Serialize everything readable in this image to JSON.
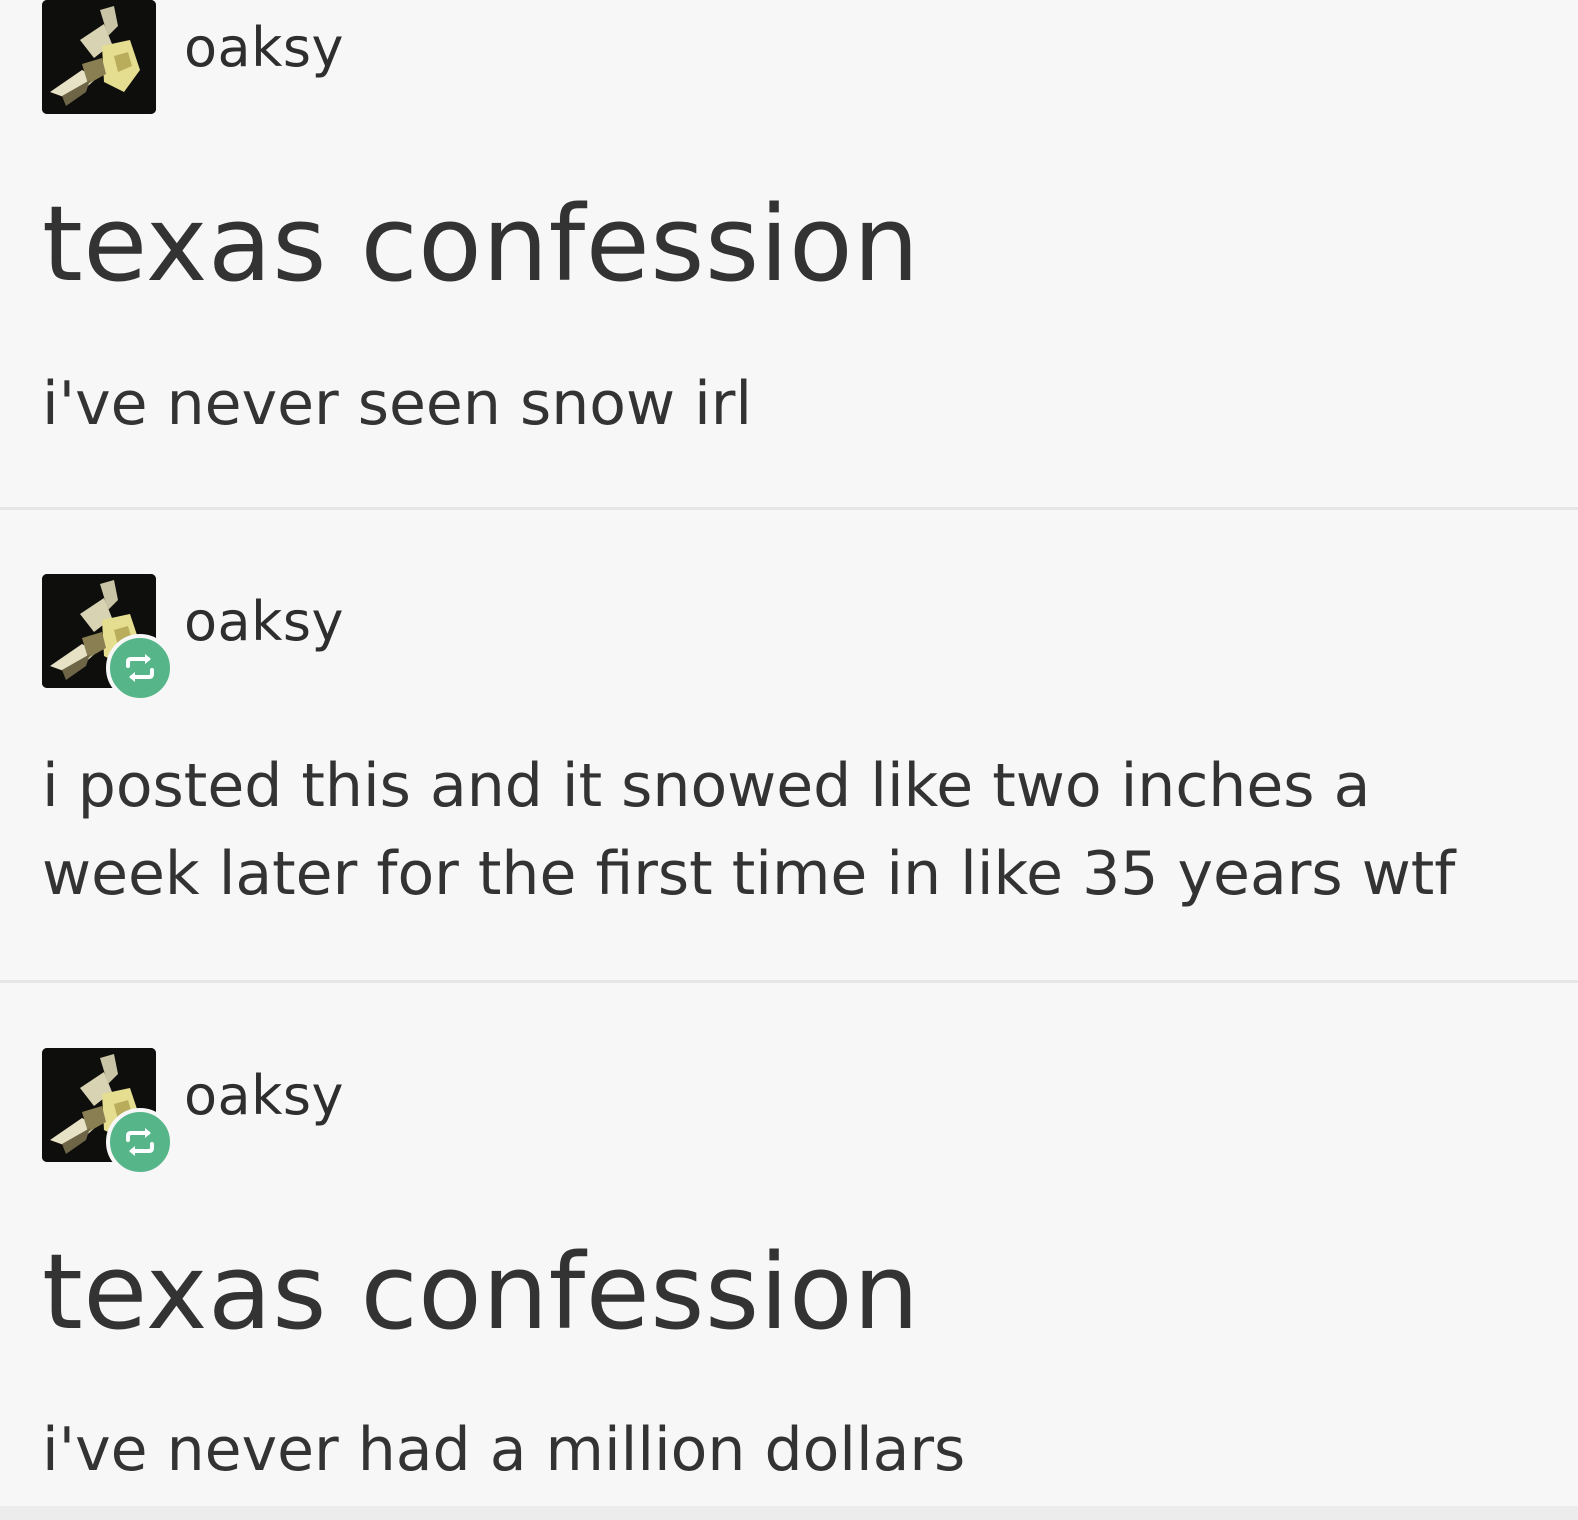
{
  "posts": [
    {
      "username": "oaksy",
      "is_reblog": false,
      "title": "texas confession",
      "body_lines": [
        "i've never seen snow irl"
      ]
    },
    {
      "username": "oaksy",
      "is_reblog": true,
      "title": "",
      "body_lines": [
        "i posted this and it snowed like two inches a",
        "week later for the first time in like 35 years wtf"
      ]
    },
    {
      "username": "oaksy",
      "is_reblog": true,
      "title": "texas confession",
      "body_lines": [
        "i've never had a million dollars"
      ]
    }
  ],
  "icons": {
    "avatar": "anime-character-avatar-icon",
    "reblog": "reblog-icon"
  },
  "colors": {
    "background": "#f7f7f7",
    "text": "#333333",
    "reblog_badge": "#56b68a",
    "divider": "#e6e6e6"
  }
}
